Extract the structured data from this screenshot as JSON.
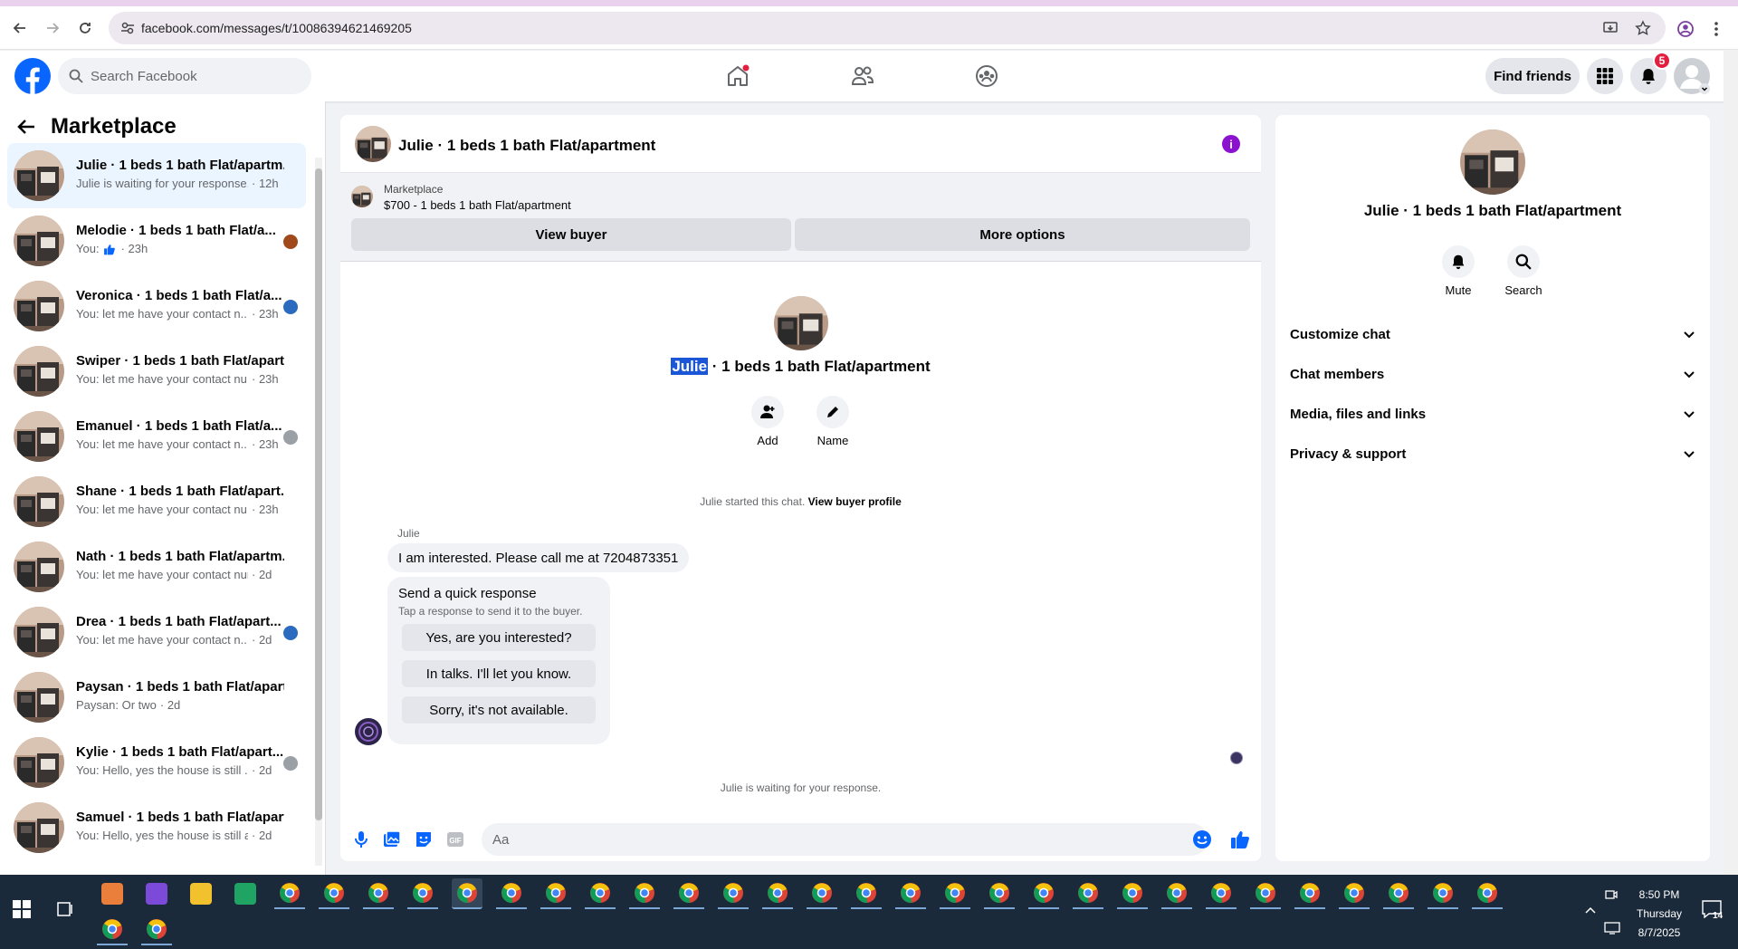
{
  "browser": {
    "url": "facebook.com/messages/t/10086394621469205"
  },
  "header": {
    "search_placeholder": "Search Facebook",
    "find_friends": "Find friends",
    "notif_count": "5"
  },
  "sidebar": {
    "title": "Marketplace",
    "conversations": [
      {
        "name": "Julie · 1 beds 1 bath Flat/apartm...",
        "snippet": "Julie is waiting for your response.",
        "time": "· 12h",
        "active": true
      },
      {
        "name": "Melodie · 1 beds 1 bath Flat/a...",
        "snippet": "You:",
        "time": "· 23h",
        "liked": true
      },
      {
        "name": "Veronica · 1 beds 1 bath Flat/a...",
        "snippet": "You: let me have your contact n...",
        "time": "· 23h"
      },
      {
        "name": "Swiper · 1 beds 1 bath Flat/apart...",
        "snippet": "You: let me have your contact nu...",
        "time": "· 23h"
      },
      {
        "name": "Emanuel · 1 beds 1 bath Flat/a...",
        "snippet": "You: let me have your contact n...",
        "time": "· 23h"
      },
      {
        "name": "Shane · 1 beds 1 bath Flat/apart...",
        "snippet": "You: let me have your contact nu...",
        "time": "· 23h"
      },
      {
        "name": "Nath · 1 beds 1 bath Flat/apartm...",
        "snippet": "You: let me have your contact num...",
        "time": "· 2d"
      },
      {
        "name": "Drea · 1 beds 1 bath Flat/apart...",
        "snippet": "You: let me have your contact n...",
        "time": "· 2d"
      },
      {
        "name": "Paysan · 1 beds 1 bath Flat/apart...",
        "snippet": "Paysan: Or two",
        "time": "· 2d"
      },
      {
        "name": "Kylie · 1 beds 1 bath Flat/apart...",
        "snippet": "You: Hello, yes the house is still ...",
        "time": "· 2d"
      },
      {
        "name": "Samuel · 1 beds 1 bath Flat/apart...",
        "snippet": "You: Hello, yes the house is still ava...",
        "time": "· 2d"
      }
    ]
  },
  "chat": {
    "title": "Julie · 1 beds 1 bath Flat/apartment",
    "marketplace_label": "Marketplace",
    "listing": "$700 - 1 beds 1 bath Flat/apartment",
    "view_buyer": "View buyer",
    "more_options": "More options",
    "hero_name_highlight": "Julie",
    "hero_name_rest": " · 1 beds 1 bath Flat/apartment",
    "add_label": "Add",
    "name_label": "Name",
    "started_text": "Julie started this chat.",
    "view_profile": "View buyer profile",
    "sender": "Julie",
    "message": "I am interested. Please call me at 7204873351",
    "quick_title": "Send a quick response",
    "quick_sub": "Tap a response to send it to the buyer.",
    "quick_replies": [
      "Yes, are you interested?",
      "In talks. I'll let you know.",
      "Sorry, it's not available."
    ],
    "waiting": "Julie is waiting for your response.",
    "input_placeholder": "Aa"
  },
  "details": {
    "title": "Julie · 1 beds 1 bath Flat/apartment",
    "mute": "Mute",
    "search": "Search",
    "sections": [
      "Customize chat",
      "Chat members",
      "Media, files and links",
      "Privacy & support"
    ]
  },
  "taskbar": {
    "time": "8:50 PM",
    "day": "Thursday",
    "date": "8/7/2025",
    "notif_count": "14"
  },
  "colors": {
    "fb_blue": "#0866ff",
    "accent_purple": "#8b12cf",
    "active_row": "#ebf5ff"
  }
}
